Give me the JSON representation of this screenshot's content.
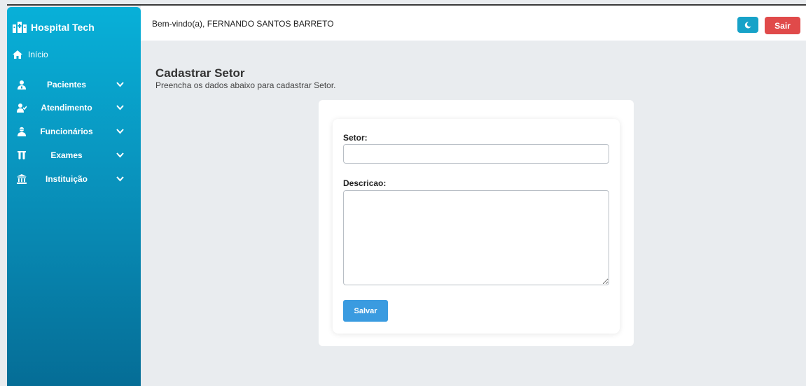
{
  "sidebar": {
    "brand": "Hospital Tech",
    "home_label": "Início",
    "items": [
      {
        "label": "Pacientes",
        "icon": "patient-icon"
      },
      {
        "label": "Atendimento",
        "icon": "user-check-icon"
      },
      {
        "label": "Funcionários",
        "icon": "employee-icon"
      },
      {
        "label": "Exames",
        "icon": "test-tubes-icon"
      },
      {
        "label": "Instituição",
        "icon": "institution-icon"
      }
    ]
  },
  "topbar": {
    "welcome": "Bem-vindo(a), FERNANDO SANTOS BARRETO",
    "logout_label": "Sair"
  },
  "page": {
    "title": "Cadastrar Setor",
    "subtitle": "Preencha os dados abaixo para cadastrar Setor."
  },
  "form": {
    "setor_label": "Setor:",
    "setor_value": "",
    "descricao_label": "Descricao:",
    "descricao_value": "",
    "save_label": "Salvar"
  },
  "colors": {
    "sidebar_top": "#08b0d8",
    "sidebar_bottom": "#056d96",
    "theme_button": "#17a2c8",
    "logout_button": "#e04a4a",
    "save_button": "#3a9be0",
    "background": "#e9ecef"
  }
}
